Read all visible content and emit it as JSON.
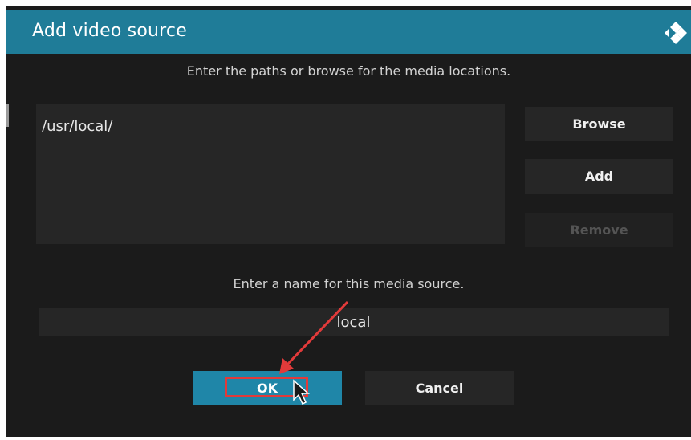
{
  "dialog": {
    "title": "Add video source",
    "logo_icon": "kodi-logo-icon",
    "paths_instruction": "Enter the paths or browse for the media locations.",
    "paths": [
      "/usr/local/"
    ],
    "buttons": {
      "browse": "Browse",
      "add": "Add",
      "remove": "Remove"
    },
    "name_instruction": "Enter a name for this media source.",
    "name_value": "local",
    "ok_label": "OK",
    "cancel_label": "Cancel"
  },
  "annotation": {
    "arrow_icon": "red-arrow-icon",
    "highlight_color": "#e23a3a",
    "cursor_icon": "mouse-pointer-icon"
  },
  "colors": {
    "accent": "#1f7c98",
    "background": "#1b1b1b",
    "panel": "#262626"
  }
}
